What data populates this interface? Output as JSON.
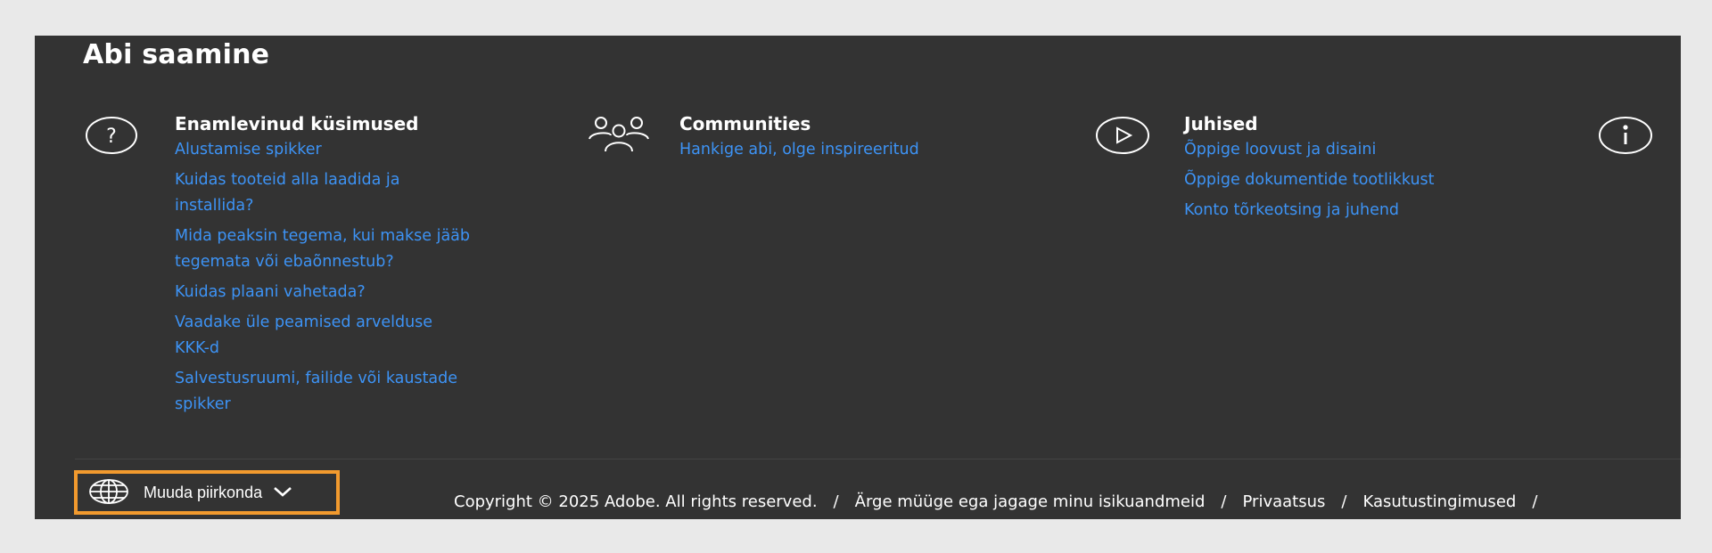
{
  "heading": "Abi saamine",
  "columns": [
    {
      "icon": "question-circle-icon",
      "title": "Enamlevinud küsimused",
      "links": [
        [
          "Alustamise spikker"
        ],
        [
          "Kuidas tooteid alla laadida ja",
          "installida?"
        ],
        [
          "Mida peaksin tegema, kui makse jääb",
          "tegemata või ebaõnnestub?"
        ],
        [
          "Kuidas plaani vahetada?"
        ],
        [
          "Vaadake üle peamised arvelduse",
          "KKK-d"
        ],
        [
          "Salvestusruumi, failide või kaustade",
          "spikker"
        ]
      ]
    },
    {
      "icon": "community-icon",
      "title": "Communities",
      "links": [
        [
          "Hankige abi, olge inspireeritud"
        ]
      ]
    },
    {
      "icon": "play-circle-icon",
      "title": "Juhised",
      "links": [
        [
          "Õppige loovust ja disaini"
        ],
        [
          "Õppige dokumentide tootlikkust"
        ],
        [
          "Konto tõrkeotsing ja juhend"
        ]
      ]
    },
    {
      "icon": "info-circle-icon"
    }
  ],
  "footer": {
    "region_label": "Muuda piirkonda",
    "copyright": "Copyright © 2025 Adobe. All rights reserved.",
    "separator": "/",
    "links": [
      "Ärge müüge ega jagage minu isikuandmeid",
      "Privaatsus",
      "Kasutustingimused"
    ]
  },
  "colors": {
    "background": "#333333",
    "link": "#3d93f5",
    "focus_outline": "#f29a2e"
  }
}
